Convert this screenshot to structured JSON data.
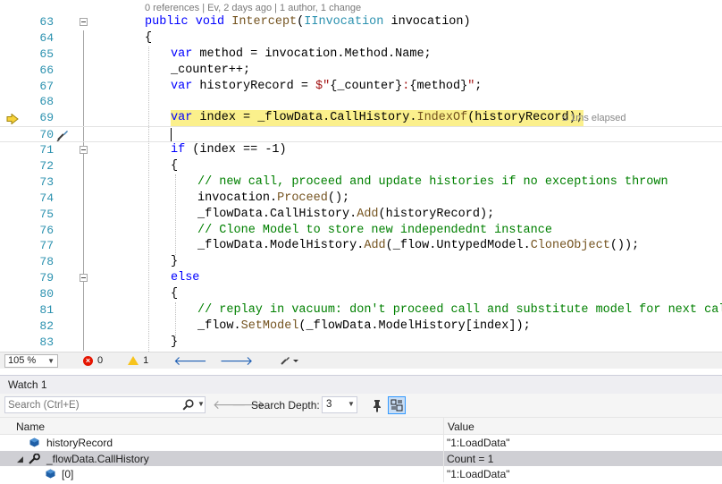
{
  "editor": {
    "codelens": "0 references | Ev, 2 days ago | 1 author, 1 change",
    "elapsed": "≤ 1ms elapsed",
    "lines": [
      {
        "num": "63",
        "text": "public void Intercept(IInvocation invocation)"
      },
      {
        "num": "64",
        "text": "{"
      },
      {
        "num": "65",
        "text": "var method = invocation.Method.Name;"
      },
      {
        "num": "66",
        "text": "_counter++;"
      },
      {
        "num": "67",
        "text": "var historyRecord = $\"{_counter}:{method}\";"
      },
      {
        "num": "68",
        "text": ""
      },
      {
        "num": "69",
        "text": "var index = _flowData.CallHistory.IndexOf(historyRecord);"
      },
      {
        "num": "70",
        "text": ""
      },
      {
        "num": "71",
        "text": "if (index == -1)"
      },
      {
        "num": "72",
        "text": "{"
      },
      {
        "num": "73",
        "text": "// new call, proceed and update histories if no exceptions thrown"
      },
      {
        "num": "74",
        "text": "invocation.Proceed();"
      },
      {
        "num": "75",
        "text": "_flowData.CallHistory.Add(historyRecord);"
      },
      {
        "num": "76",
        "text": "// Clone Model to store new independednt instance"
      },
      {
        "num": "77",
        "text": "_flowData.ModelHistory.Add(_flow.UntypedModel.CloneObject());"
      },
      {
        "num": "78",
        "text": "}"
      },
      {
        "num": "79",
        "text": "else"
      },
      {
        "num": "80",
        "text": "{"
      },
      {
        "num": "81",
        "text": "// replay in vacuum: don't proceed call and substitute model for next call"
      },
      {
        "num": "82",
        "text": "_flow.SetModel(_flowData.ModelHistory[index]);"
      },
      {
        "num": "83",
        "text": "}"
      }
    ]
  },
  "status_bar": {
    "zoom": "105 %",
    "errors": "0",
    "warnings": "1",
    "icons": [
      "error-icon",
      "warning-icon",
      "back-arrow-icon",
      "forward-arrow-icon",
      "brush-icon"
    ]
  },
  "watch": {
    "title": "Watch 1",
    "search_placeholder": "Search (Ctrl+E)",
    "search_depth_label": "Search Depth:",
    "search_depth_value": "3",
    "columns": {
      "name": "Name",
      "value": "Value"
    },
    "rows": [
      {
        "name": "historyRecord",
        "value": "\"1:LoadData\"",
        "icon": "field-icon"
      },
      {
        "name": "_flowData.CallHistory",
        "value": "Count = 1",
        "icon": "property-wrench-icon",
        "expanded": true
      },
      {
        "name": "[0]",
        "value": "\"1:LoadData\"",
        "icon": "field-icon"
      }
    ]
  },
  "colors": {
    "keyword": "#0000ff",
    "type": "#2b91af",
    "string": "#a31515",
    "comment": "#008000",
    "method": "#74531f",
    "highlight": "#fbf08c",
    "selection": "#cfcfd4"
  }
}
